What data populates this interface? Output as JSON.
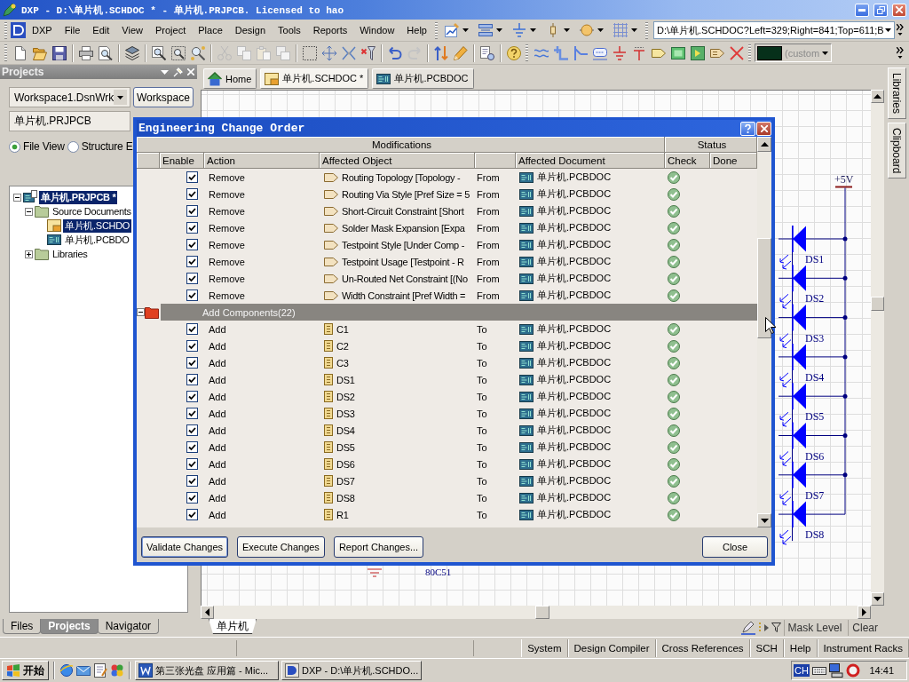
{
  "window": {
    "title": "DXP - D:\\单片机.SCHDOC * - 单片机.PRJPCB. Licensed to hao"
  },
  "menu": [
    "DXP",
    "File",
    "Edit",
    "View",
    "Project",
    "Place",
    "Design",
    "Tools",
    "Reports",
    "Window",
    "Help"
  ],
  "address_bar": {
    "value": "D:\\单片机.SCHDOC?Left=329;Right=841;Top=611;B"
  },
  "color_combo": {
    "value": "(custom"
  },
  "projects_panel": {
    "title": "Projects",
    "workspace_combo": {
      "value": "Workspace1.DsnWrk"
    },
    "workspace_button": "Workspace",
    "project_field": {
      "value": "单片机.PRJPCB"
    },
    "view_options": [
      {
        "label": "File View",
        "selected": true
      },
      {
        "label": "Structure E",
        "selected": false
      }
    ],
    "tree": [
      {
        "label": "单片机.PRJPCB *",
        "kind": "project",
        "selected": true,
        "expanded": true,
        "children": [
          {
            "label": "Source Documents",
            "kind": "folder",
            "selected": false,
            "expanded": true,
            "children": [
              {
                "label": "单片机.SCHDO",
                "kind": "schematic",
                "selected": true
              },
              {
                "label": "单片机.PCBDO",
                "kind": "pcb",
                "selected": false
              }
            ]
          },
          {
            "label": "Libraries",
            "kind": "folder",
            "selected": false,
            "expanded": false
          }
        ]
      }
    ],
    "tabs": [
      {
        "label": "Files",
        "selected": false
      },
      {
        "label": "Projects",
        "selected": true
      },
      {
        "label": "Navigator",
        "selected": false
      }
    ]
  },
  "document_tabs": [
    {
      "label": "Home",
      "kind": "home",
      "selected": false
    },
    {
      "label": "单片机.SCHDOC *",
      "kind": "schematic",
      "selected": true
    },
    {
      "label": "单片机.PCBDOC",
      "kind": "pcb",
      "selected": false
    }
  ],
  "side_tabs": [
    "Libraries",
    "Clipboard"
  ],
  "schematic": {
    "power_label": "+5V",
    "leds": [
      "DS1",
      "DS2",
      "DS3",
      "DS4",
      "DS5",
      "DS6",
      "DS7",
      "DS8"
    ],
    "chip_label": "80C51"
  },
  "sheet_tab": "单片机",
  "mask_bar": {
    "mask_level": "Mask Level",
    "clear": "Clear"
  },
  "dialog": {
    "title": "Engineering Change Order",
    "column_groups": [
      "Modifications",
      "Status"
    ],
    "columns": [
      "Enable",
      "Action",
      "Affected Object",
      "Affected Document",
      "Check",
      "Done"
    ],
    "rows": [
      {
        "kind": "rule",
        "checked": true,
        "action": "Remove",
        "object": "Routing Topology [Topology -",
        "direction": "From",
        "document": "单片机.PCBDOC",
        "check_passed": true
      },
      {
        "kind": "rule",
        "checked": true,
        "action": "Remove",
        "object": "Routing Via Style [Pref Size = 5",
        "direction": "From",
        "document": "单片机.PCBDOC",
        "check_passed": true
      },
      {
        "kind": "rule",
        "checked": true,
        "action": "Remove",
        "object": "Short-Circuit Constraint [Short",
        "direction": "From",
        "document": "单片机.PCBDOC",
        "check_passed": true
      },
      {
        "kind": "rule",
        "checked": true,
        "action": "Remove",
        "object": "Solder Mask Expansion [Expa",
        "direction": "From",
        "document": "单片机.PCBDOC",
        "check_passed": true
      },
      {
        "kind": "rule",
        "checked": true,
        "action": "Remove",
        "object": "Testpoint Style [Under Comp -",
        "direction": "From",
        "document": "单片机.PCBDOC",
        "check_passed": true
      },
      {
        "kind": "rule",
        "checked": true,
        "action": "Remove",
        "object": "Testpoint Usage [Testpoint - R",
        "direction": "From",
        "document": "单片机.PCBDOC",
        "check_passed": true
      },
      {
        "kind": "rule",
        "checked": true,
        "action": "Remove",
        "object": "Un-Routed Net Constraint [(No",
        "direction": "From",
        "document": "单片机.PCBDOC",
        "check_passed": true
      },
      {
        "kind": "rule",
        "checked": true,
        "action": "Remove",
        "object": "Width Constraint [Pref Width =",
        "direction": "From",
        "document": "单片机.PCBDOC",
        "check_passed": true
      },
      {
        "kind": "group",
        "expanded": true,
        "label": "Add Components(22)"
      },
      {
        "kind": "component",
        "checked": true,
        "action": "Add",
        "object": "C1",
        "direction": "To",
        "document": "单片机.PCBDOC",
        "check_passed": true
      },
      {
        "kind": "component",
        "checked": true,
        "action": "Add",
        "object": "C2",
        "direction": "To",
        "document": "单片机.PCBDOC",
        "check_passed": true
      },
      {
        "kind": "component",
        "checked": true,
        "action": "Add",
        "object": "C3",
        "direction": "To",
        "document": "单片机.PCBDOC",
        "check_passed": true
      },
      {
        "kind": "component",
        "checked": true,
        "action": "Add",
        "object": "DS1",
        "direction": "To",
        "document": "单片机.PCBDOC",
        "check_passed": true
      },
      {
        "kind": "component",
        "checked": true,
        "action": "Add",
        "object": "DS2",
        "direction": "To",
        "document": "单片机.PCBDOC",
        "check_passed": true
      },
      {
        "kind": "component",
        "checked": true,
        "action": "Add",
        "object": "DS3",
        "direction": "To",
        "document": "单片机.PCBDOC",
        "check_passed": true
      },
      {
        "kind": "component",
        "checked": true,
        "action": "Add",
        "object": "DS4",
        "direction": "To",
        "document": "单片机.PCBDOC",
        "check_passed": true
      },
      {
        "kind": "component",
        "checked": true,
        "action": "Add",
        "object": "DS5",
        "direction": "To",
        "document": "单片机.PCBDOC",
        "check_passed": true
      },
      {
        "kind": "component",
        "checked": true,
        "action": "Add",
        "object": "DS6",
        "direction": "To",
        "document": "单片机.PCBDOC",
        "check_passed": true
      },
      {
        "kind": "component",
        "checked": true,
        "action": "Add",
        "object": "DS7",
        "direction": "To",
        "document": "单片机.PCBDOC",
        "check_passed": true
      },
      {
        "kind": "component",
        "checked": true,
        "action": "Add",
        "object": "DS8",
        "direction": "To",
        "document": "单片机.PCBDOC",
        "check_passed": true
      },
      {
        "kind": "component",
        "checked": true,
        "action": "Add",
        "object": "R1",
        "direction": "To",
        "document": "单片机.PCBDOC",
        "check_passed": true
      }
    ],
    "buttons": [
      {
        "label": "Validate Changes",
        "focused": true
      },
      {
        "label": "Execute Changes",
        "focused": false
      },
      {
        "label": "Report Changes...",
        "focused": false
      }
    ],
    "close_button": "Close"
  },
  "status_bar": [
    "System",
    "Design Compiler",
    "Cross References",
    "SCH",
    "Help",
    "Instrument Racks"
  ],
  "taskbar": {
    "start": "开始",
    "tasks": [
      {
        "label": "第三张光盘 应用篇 - Mic...",
        "kind": "word"
      },
      {
        "label": "DXP - D:\\单片机.SCHDO...",
        "kind": "dxp"
      }
    ],
    "input_method": "CH",
    "clock": "14:41"
  }
}
